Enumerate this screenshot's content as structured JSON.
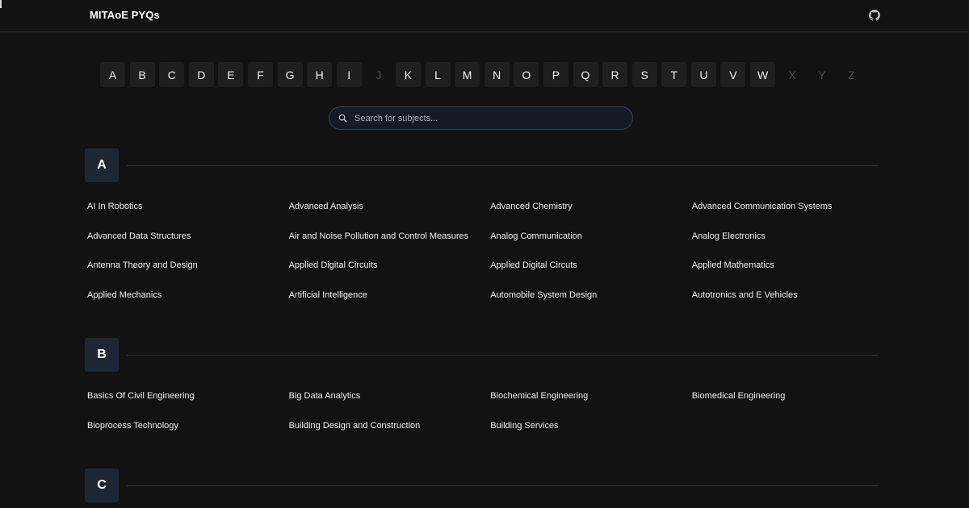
{
  "nav": {
    "brand": "MITAoE PYQs",
    "github_icon": "github-icon"
  },
  "alphabet": [
    {
      "letter": "A",
      "enabled": true
    },
    {
      "letter": "B",
      "enabled": true
    },
    {
      "letter": "C",
      "enabled": true
    },
    {
      "letter": "D",
      "enabled": true
    },
    {
      "letter": "E",
      "enabled": true
    },
    {
      "letter": "F",
      "enabled": true
    },
    {
      "letter": "G",
      "enabled": true
    },
    {
      "letter": "H",
      "enabled": true
    },
    {
      "letter": "I",
      "enabled": true
    },
    {
      "letter": "J",
      "enabled": false
    },
    {
      "letter": "K",
      "enabled": true
    },
    {
      "letter": "L",
      "enabled": true
    },
    {
      "letter": "M",
      "enabled": true
    },
    {
      "letter": "N",
      "enabled": true
    },
    {
      "letter": "O",
      "enabled": true
    },
    {
      "letter": "P",
      "enabled": true
    },
    {
      "letter": "Q",
      "enabled": true
    },
    {
      "letter": "R",
      "enabled": true
    },
    {
      "letter": "S",
      "enabled": true
    },
    {
      "letter": "T",
      "enabled": true
    },
    {
      "letter": "U",
      "enabled": true
    },
    {
      "letter": "V",
      "enabled": true
    },
    {
      "letter": "W",
      "enabled": true
    },
    {
      "letter": "X",
      "enabled": false
    },
    {
      "letter": "Y",
      "enabled": false
    },
    {
      "letter": "Z",
      "enabled": false
    }
  ],
  "search": {
    "placeholder": "Search for subjects...",
    "value": "",
    "icon": "search-icon"
  },
  "sections": [
    {
      "letter": "A",
      "subjects": [
        "AI In Robotics",
        "Advanced Analysis",
        "Advanced Chemistry",
        "Advanced Communication Systems",
        "Advanced Data Structures",
        "Air and Noise Pollution and Control Measures",
        "Analog Communication",
        "Analog Electronics",
        "Antenna Theory and Design",
        "Applied Digital Circuits",
        "Applied Digital Circuts",
        "Applied Mathematics",
        "Applied Mechanics",
        "Artificial Intelligence",
        "Automobile System Design",
        "Autotronics and E Vehicles"
      ]
    },
    {
      "letter": "B",
      "subjects": [
        "Basics Of Civil Engineering",
        "Big Data Analytics",
        "Biochemical Engineering",
        "Biomedical Engineering",
        "Bioprocess Technology",
        "Building Design and Construction",
        "Building Services"
      ]
    },
    {
      "letter": "C",
      "subjects": []
    }
  ],
  "colors": {
    "background": "#121212",
    "letter_button": "#1f1f1f",
    "section_badge": "#1e2634",
    "search_border": "#3a4252"
  }
}
